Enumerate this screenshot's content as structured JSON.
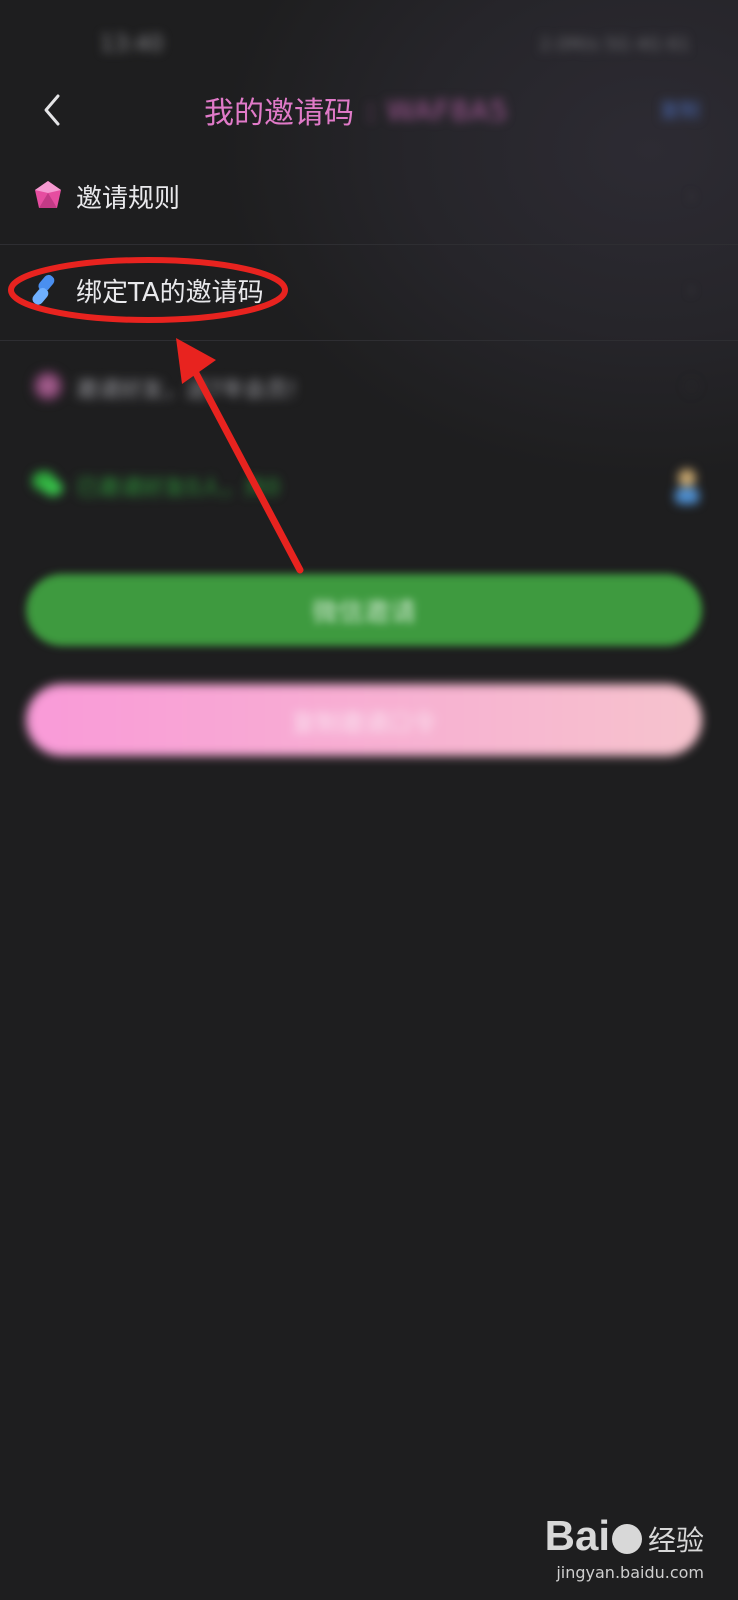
{
  "status_bar": {
    "time": "13:40",
    "indicators": "2.0M/s 5G 4G 61"
  },
  "header": {
    "back_icon": "chevron-left-icon",
    "title": "我的邀请码",
    "code": ": WAF8A5",
    "copy_label": "复制"
  },
  "menu": {
    "items": [
      {
        "icon": "gem-icon",
        "label": "邀请规则"
      },
      {
        "icon": "link-icon",
        "label": "绑定TA的邀请码"
      },
      {
        "icon": "badge-icon",
        "label": "邀请好友，送7年会员!"
      },
      {
        "icon": "wechat-icon",
        "label": "已邀请好友0人，共0"
      }
    ]
  },
  "buttons": {
    "wechat_invite": "微信邀请",
    "share_invite": "复制邀请口令"
  },
  "annotation": {
    "color": "#e8231f"
  },
  "watermark": {
    "logo": "Bai",
    "logo_suffix": "经验",
    "url": "jingyan.baidu.com"
  },
  "colors": {
    "background": "#1e1e1f",
    "title_pink": "#e07ac8",
    "wechat_green": "#3e9a3f"
  }
}
